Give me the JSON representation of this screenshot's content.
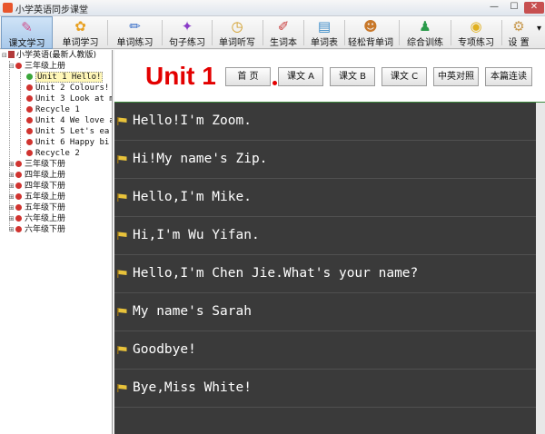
{
  "window": {
    "title": "小学英语同步课堂",
    "controls": {
      "minimize": "—",
      "maximize": "☐",
      "close": "✕"
    }
  },
  "toolbar": {
    "items": [
      {
        "label": "课文学习",
        "icon": "text-study-icon",
        "glyph": "✎",
        "color": "#d0508c",
        "active": true
      },
      {
        "label": "单词学习",
        "icon": "flower-icon",
        "glyph": "✿",
        "color": "#e8a020",
        "active": false
      },
      {
        "label": "单词练习",
        "icon": "pencils-icon",
        "glyph": "✏",
        "color": "#3a6fc8",
        "active": false
      },
      {
        "label": "句子练习",
        "icon": "bulb-icon",
        "glyph": "✦",
        "color": "#8a3cc8",
        "active": false
      },
      {
        "label": "单词听写",
        "icon": "clock-icon",
        "glyph": "◷",
        "color": "#d09a20",
        "active": false
      },
      {
        "label": "生词本",
        "icon": "notebook-icon",
        "glyph": "✐",
        "color": "#c83a3a",
        "active": false
      },
      {
        "label": "单词表",
        "icon": "word-list-icon",
        "glyph": "▤",
        "color": "#3a8ac8",
        "active": false
      },
      {
        "label": "轻松背单词",
        "icon": "head-icon",
        "glyph": "☻",
        "color": "#c8782a",
        "active": false
      },
      {
        "label": "综合训练",
        "icon": "people-icon",
        "glyph": "♟",
        "color": "#2a9a4a",
        "active": false
      },
      {
        "label": "专项练习",
        "icon": "target-icon",
        "glyph": "◉",
        "color": "#e0b020",
        "active": false
      },
      {
        "label": "设 置",
        "icon": "settings-icon",
        "glyph": "⚙",
        "color": "#c89a50",
        "active": false
      }
    ],
    "more": "▾"
  },
  "tree": {
    "root": "小学英语(最新人教版)",
    "expanded_grade": "三年级上册",
    "units": [
      {
        "label": "Unit 1 Hello!",
        "selected": true
      },
      {
        "label": "Unit 2 Colours!",
        "selected": false
      },
      {
        "label": "Unit 3 Look at m",
        "selected": false
      },
      {
        "label": "Recycle 1",
        "selected": false
      },
      {
        "label": "Unit 4 We love a",
        "selected": false
      },
      {
        "label": "Unit 5 Let's ea",
        "selected": false
      },
      {
        "label": "Unit 6 Happy bi",
        "selected": false
      },
      {
        "label": "Recycle 2",
        "selected": false
      }
    ],
    "grades": [
      "三年级下册",
      "四年级上册",
      "四年级下册",
      "五年级上册",
      "五年级下册",
      "六年级上册",
      "六年级下册"
    ]
  },
  "header": {
    "unit_title": "Unit 1",
    "buttons": [
      "首 页",
      "课文 A",
      "课文 B",
      "课文 C",
      "中英对照",
      "本篇连读"
    ]
  },
  "sentences": [
    "Hello!I'm Zoom.",
    "Hi!My name's Zip.",
    "Hello,I'm Mike.",
    "Hi,I'm Wu Yifan.",
    "Hello,I'm Chen Jie.What's your name?",
    "My name's Sarah",
    "Goodbye!",
    "Bye,Miss White!"
  ],
  "colors": {
    "accent_red": "#e30000",
    "content_bg": "#3a3a3a",
    "flag": "#e8c23a"
  }
}
